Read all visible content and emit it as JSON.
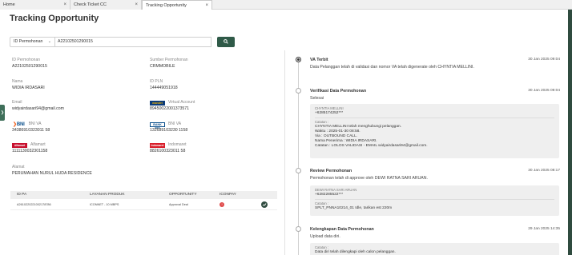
{
  "tabs": [
    {
      "label": "Home"
    },
    {
      "label": "Check Ticket CC"
    },
    {
      "label": "Tracking Opportunity"
    }
  ],
  "page_title": "Tracking Opportunity",
  "search": {
    "select_value": "ID Permohonan",
    "input_value": "A22102501290015"
  },
  "details": {
    "id_permohonan": {
      "label": "ID Permohonan",
      "value": "A22102501290015"
    },
    "sumber_permohonan": {
      "label": "Sumber Permohonan",
      "value": "CRMMOBILE"
    },
    "nama": {
      "label": "Nama",
      "value": "WIDIA IRDASARI"
    },
    "id_pln": {
      "label": "ID PLN",
      "value": "144449051918"
    },
    "email": {
      "label": "Email",
      "value": "widyairdasari94@gmail.com"
    },
    "virtual_account": {
      "label": "Virtual Account",
      "value": "89450022001373571",
      "logo": "mandiri"
    },
    "bni_va": {
      "label": "BNI VA",
      "value": "34386910323011 58",
      "logo": "BNI"
    },
    "bni_va_2": {
      "label": "BNI VA",
      "value": "132689103230 1158",
      "logo": "BANK BNI"
    },
    "alfamart": {
      "label": "Alfamart",
      "value": "1111130032301158",
      "logo": "Alfamart"
    },
    "indomaret": {
      "label": "Indomaret",
      "value": "8826100323011 58",
      "logo": "Indomaret"
    },
    "alamat": {
      "label": "Alamat",
      "value": "PERUMAHAN NURUL HUDA RESIDENCE"
    }
  },
  "table": {
    "headers": [
      "ID PA",
      "LAYANAN PRODUK",
      "OPPORTUNITY",
      "ICONPAY",
      ""
    ],
    "rows": [
      {
        "id_pa": "A2610220221002178786",
        "layanan": "ICONNET - 10 MBPS",
        "opportunity": "Approval Deal",
        "iconpay_badge": "!"
      }
    ]
  },
  "timeline": [
    {
      "title": "VA Terbit",
      "time": "30 Jan 2025 09:04",
      "desc": "Data Pelanggan telah di validasi dan nomor VA telah digenerate oleh CHYNTIA MELLINI."
    },
    {
      "title": "Verifikasi Data Permohonan",
      "time": "30 Jan 2025 09:04",
      "desc": "Selesai",
      "card": {
        "name": "CHYNTIA MELLINI",
        "phone": "+6285174252***",
        "catatan_label": "Catatan :",
        "lines": [
          "CHYNTIA MELLINI telah menghubungi pelanggan.",
          "Waktu : 2025-01-30 08:58.",
          "Via : OUTBOUND CALL.",
          "Nama Penerima : WIDIA IRDASARI.",
          "Catatan : LOLOS VALIDASI - EMAIL widyairdasari94@gmail.com."
        ]
      }
    },
    {
      "title": "Review Permohonan",
      "time": "30 Jan 2025 08:17",
      "desc": "Permohonan telah di approve oleh DEWI RATNA SARI ARUAN.",
      "card": {
        "name": "DEWI RATNA SARI ARUAN",
        "phone": "+6282285522***",
        "catatan_label": "Catatan :",
        "lines": [
          "SPLT_PNNA10214_01 Idle, tarikan est 220m"
        ]
      }
    },
    {
      "title": "Kelengkapan Data Permohonan",
      "time": "29 Jan 2025 14:35",
      "desc": "Upload data diri.",
      "card": {
        "catatan_label": "Catatan :",
        "lines": [
          "Data diri telah dilengkapi oleh calon pelanggan."
        ]
      }
    }
  ]
}
